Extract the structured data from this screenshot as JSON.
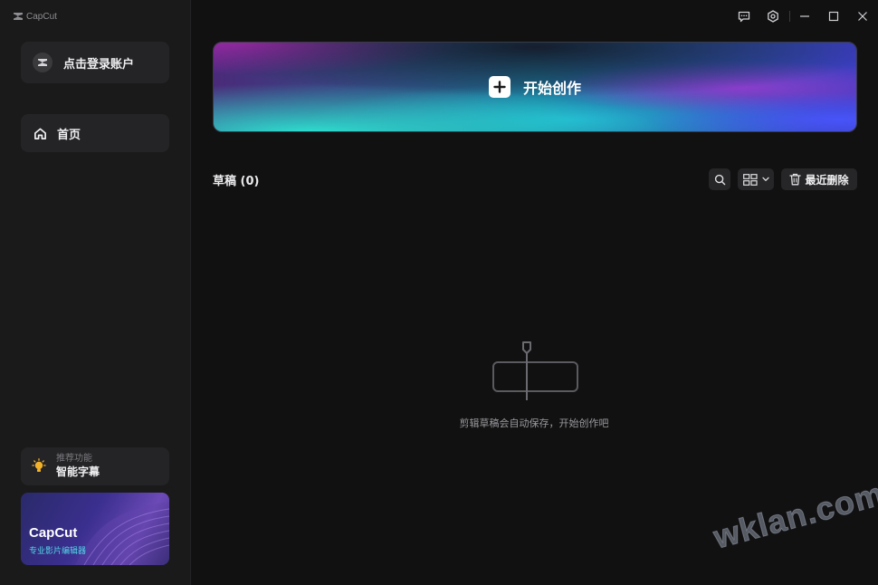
{
  "app": {
    "logo_text": "CapCut"
  },
  "sidebar": {
    "login_label": "点击登录账户",
    "home_label": "首页",
    "feature": {
      "caption": "推荐功能",
      "title": "智能字幕"
    },
    "promo": {
      "brand": "CapCut",
      "tagline": "专业影片编辑器"
    }
  },
  "main": {
    "create_label": "开始创作",
    "drafts_title": "草稿 (0)",
    "recent_deleted_label": "最近删除",
    "empty_message": "剪辑草稿会自动保存，开始创作吧"
  },
  "watermark": "wklan.com",
  "icons": [
    "logo-icon",
    "feedback-icon",
    "settings-icon",
    "minimize-icon",
    "maximize-icon",
    "close-icon",
    "user-icon",
    "home-icon",
    "lightbulb-icon",
    "plus-icon",
    "search-icon",
    "grid-view-icon",
    "chevron-down-icon",
    "trash-icon",
    "empty-timeline-icon"
  ],
  "colors": {
    "background": "#111112",
    "sidebar": "#1a1a1b",
    "card": "#242426",
    "accent_cyan": "#2ad0d2",
    "accent_purple": "#7a3fc9",
    "bulb": "#f2b22a"
  }
}
